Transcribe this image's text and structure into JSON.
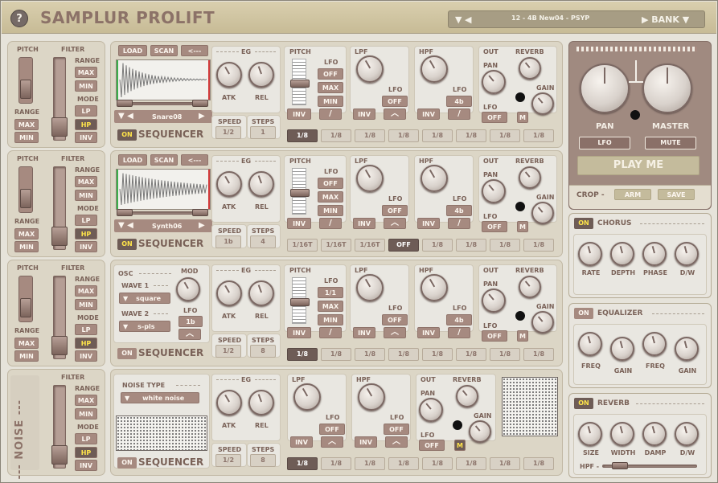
{
  "app": {
    "title": "SAMPLUR PROLIFT",
    "help": "?"
  },
  "bank": {
    "prev": "▼ ◀",
    "preset": "12 - 4B New04 - PSYP",
    "next": "▶ BANK ▼"
  },
  "common": {
    "pitch": "PITCH",
    "filter": "FILTER",
    "range": "RANGE",
    "mode": "MODE",
    "max": "MAX",
    "min": "MIN",
    "lp": "LP",
    "hp": "HP",
    "inv": "INV",
    "eg": "EG",
    "atk": "ATK",
    "rel": "REL",
    "lfo": "LFO",
    "off": "OFF",
    "lpf": "LPF",
    "hpf": "HPF",
    "out": "OUT",
    "pan": "PAN",
    "reverb": "REVERB",
    "gain": "GAIN",
    "m": "M",
    "speed": "SPEED",
    "steps": "STEPS",
    "on": "ON",
    "sequencer": "SEQUENCER",
    "load": "LOAD",
    "scan": "SCAN",
    "back": "<---",
    "dashes": "----------",
    "nav": "▼ ◀",
    "navnext": "▶"
  },
  "channels": [
    {
      "sample": "Snare08",
      "seq_on": true,
      "speed": "1/2",
      "steps": "1",
      "pitch_lfo": "OFF",
      "lpf_lfo": "OFF",
      "hpf_lfo": "4b",
      "out_lfo": "OFF",
      "steps_values": [
        "1/8",
        "1/8",
        "1/8",
        "1/8",
        "1/8",
        "1/8",
        "1/8",
        "1/8"
      ],
      "selected": 0
    },
    {
      "sample": "Synth06",
      "seq_on": true,
      "speed": "1b",
      "steps": "4",
      "pitch_lfo": "OFF",
      "lpf_lfo": "OFF",
      "hpf_lfo": "4b",
      "out_lfo": "OFF",
      "steps_values": [
        "1/16T",
        "1/16T",
        "1/16T",
        "OFF",
        "1/8",
        "1/8",
        "1/8",
        "1/8"
      ],
      "selected": 3
    },
    {
      "osc_label": "OSC",
      "wave1_label": "WAVE 1",
      "wave1": "square",
      "wave2_label": "WAVE 2",
      "wave2": "s-pls",
      "mod_label": "MOD",
      "mod_lfo": "1b",
      "seq_on": false,
      "speed": "1/2",
      "steps": "8",
      "pitch_lfo": "1/1",
      "lpf_lfo": "OFF",
      "hpf_lfo": "4b",
      "out_lfo": "OFF",
      "steps_values": [
        "1/8",
        "1/8",
        "1/8",
        "1/8",
        "1/8",
        "1/8",
        "1/8",
        "1/8"
      ],
      "selected": 0
    },
    {
      "noise_label": "NOISE",
      "noise_type_label": "NOISE TYPE",
      "noise_type": "white noise",
      "seq_on": false,
      "speed": "1/2",
      "steps": "8",
      "lpf_lfo": "OFF",
      "hpf_lfo": "OFF",
      "out_lfo": "OFF",
      "steps_values": [
        "1/8",
        "1/8",
        "1/8",
        "1/8",
        "1/8",
        "1/8",
        "1/8",
        "1/8"
      ],
      "selected": 0
    }
  ],
  "master": {
    "pan": "PAN",
    "master": "MASTER",
    "lfo": "LFO",
    "mute": "MUTE",
    "play": "PLAY ME",
    "crop": "CROP -",
    "arm": "ARM",
    "save": "SAVE"
  },
  "fx": {
    "chorus": {
      "on": "ON",
      "title": "CHORUS",
      "knobs": [
        "RATE",
        "DEPTH",
        "PHASE",
        "D/W"
      ]
    },
    "equalizer": {
      "on": "ON",
      "title": "EQUALIZER",
      "knobs": [
        "FREQ",
        "GAIN",
        "FREQ",
        "GAIN"
      ]
    },
    "reverb": {
      "on": "ON",
      "title": "REVERB",
      "knobs": [
        "SIZE",
        "WIDTH",
        "DAMP",
        "D/W"
      ],
      "hpf": "HPF -"
    }
  },
  "colors": {
    "accent": "#a68a80",
    "dark": "#6e5c56",
    "on_yellow": "#ffe44a",
    "panel": "#e9e7e1"
  }
}
